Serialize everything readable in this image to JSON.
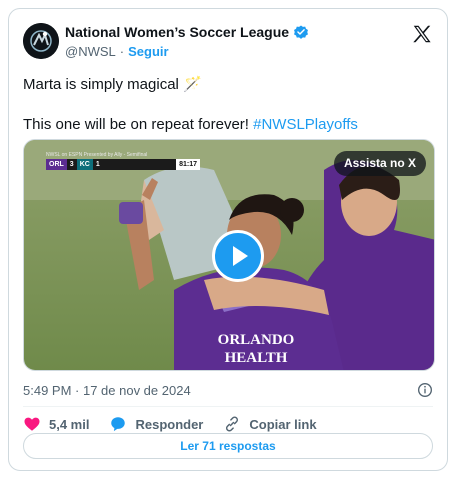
{
  "account": {
    "name": "National Women’s Soccer League",
    "handle": "@NWSL",
    "separator": "·",
    "follow_label": "Seguir"
  },
  "post": {
    "line1": "Marta is simply magical 🪄",
    "line2_prefix": "This one will be on repeat forever! ",
    "hashtag": "#NWSLPlayoffs"
  },
  "media": {
    "watch_label": "Assista no X",
    "scorebug": {
      "header": "NWSL on ESPN Presented by Ally - Semifinal",
      "team1": "ORL",
      "score1": "3",
      "team2": "KC",
      "score2": "1",
      "clock": "81:17"
    },
    "jersey_text_line1": "ORLANDO",
    "jersey_text_line2": "HEALTH"
  },
  "timestamp": "5:49 PM · 17 de nov de 2024",
  "actions": {
    "likes": "5,4 mil",
    "reply_label": "Responder",
    "copy_label": "Copiar link"
  },
  "replies_button": "Ler 71 respostas",
  "colors": {
    "accent": "#1d9bf0",
    "like": "#f91880",
    "text_secondary": "#536471",
    "orlando_purple": "#5c2d91"
  }
}
